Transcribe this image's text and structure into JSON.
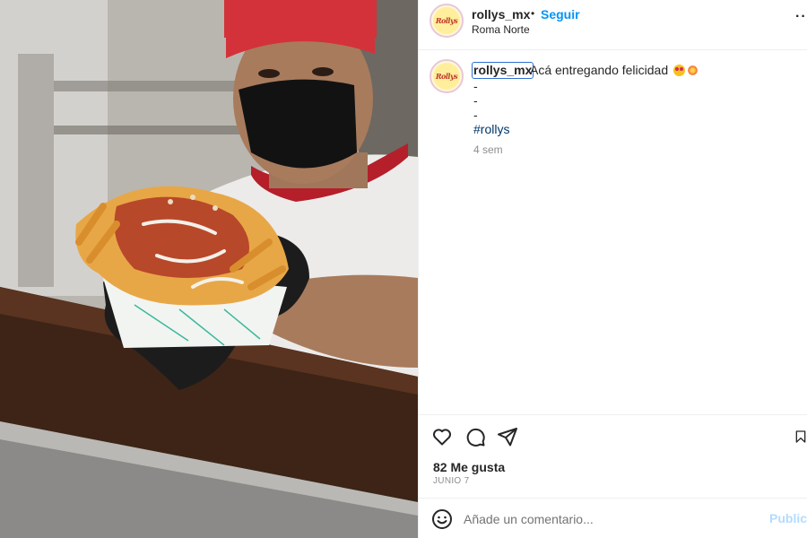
{
  "post": {
    "username": "rollys_mx",
    "follow_label": "Seguir",
    "separator": "•",
    "location": "Roma Norte",
    "more_label": "··",
    "avatar_text": "Rollys"
  },
  "caption": {
    "username": "rollys_mx",
    "text": "Acá entregando felicidad",
    "emojis": [
      "heart-eyes-emoji",
      "boom-emoji"
    ],
    "lines": [
      "-",
      "-",
      "-"
    ],
    "hashtag": "#rollys",
    "time_ago": "4 sem"
  },
  "actions": {
    "icons": [
      "heart-icon",
      "comment-icon",
      "share-icon",
      "bookmark-icon"
    ]
  },
  "likes_text": "82 Me gusta",
  "date_text": "JUNIO 7",
  "comment": {
    "placeholder": "Añade un comentario...",
    "value": "",
    "post_label": "Publicar"
  },
  "colors": {
    "follow": "#0095f6",
    "hashtag": "#00376b",
    "post_disabled": "#b3dbff",
    "selection_outline": "#2f6fd1"
  }
}
